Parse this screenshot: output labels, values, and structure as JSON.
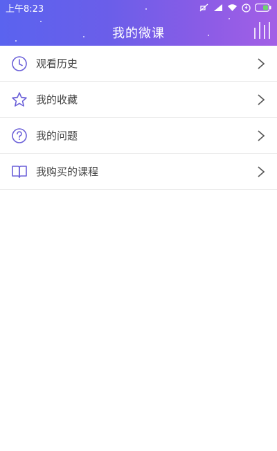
{
  "status_bar": {
    "time": "上午8:23",
    "icons": [
      "mute-icon",
      "signal-icon",
      "wifi-icon",
      "sync-icon",
      "battery-icon"
    ]
  },
  "header": {
    "title": "我的微课",
    "menu_icon": "bars-menu-icon"
  },
  "colors": {
    "header_gradient_start": "#5a63ef",
    "header_gradient_end": "#a35fe6",
    "icon_accent": "#6a5fd8",
    "label_text": "#444444",
    "divider": "#ececec"
  },
  "menu": {
    "items": [
      {
        "label": "观看历史",
        "icon": "clock-icon"
      },
      {
        "label": "我的收藏",
        "icon": "star-icon"
      },
      {
        "label": "我的问题",
        "icon": "question-icon"
      },
      {
        "label": "我购买的课程",
        "icon": "book-icon"
      }
    ]
  }
}
